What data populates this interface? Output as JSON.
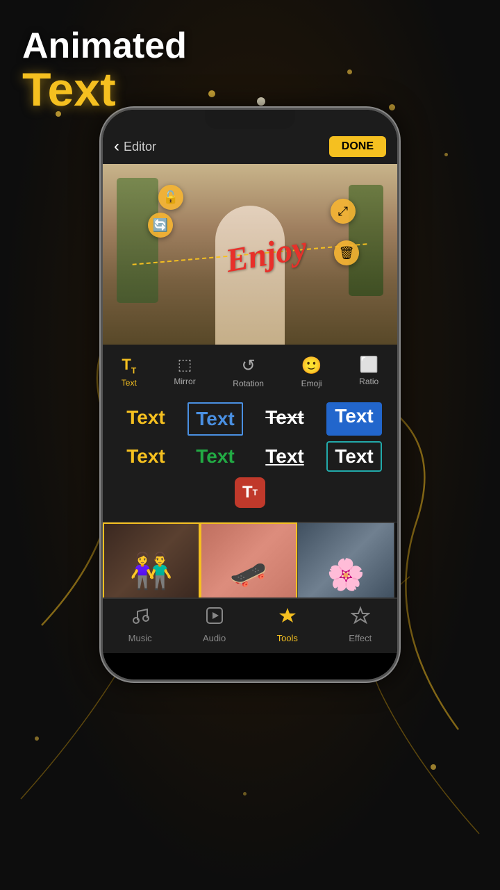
{
  "app": {
    "title_line1": "Animated",
    "title_line2": "Text",
    "colors": {
      "gold": "#f5c020",
      "white": "#ffffff",
      "dark_bg": "#1a1008",
      "active_gold": "#f5c020"
    }
  },
  "editor": {
    "back_icon": "‹",
    "label": "Editor",
    "done_button": "DONE",
    "enjoy_text": "Enjoy",
    "photo_icons": {
      "lock": "🔓",
      "rotate": "🔄",
      "move": "⤢",
      "trash": "🗑"
    }
  },
  "toolbar": {
    "items": [
      {
        "id": "text",
        "label": "Text",
        "icon": "Tₜ",
        "active": true
      },
      {
        "id": "mirror",
        "label": "Mirror",
        "icon": "⬚",
        "active": false
      },
      {
        "id": "rotation",
        "label": "Rotation",
        "icon": "↺",
        "active": false
      },
      {
        "id": "emoji",
        "label": "Emoji",
        "icon": "☺",
        "active": false
      },
      {
        "id": "ratio",
        "label": "Ratio",
        "icon": "⬜",
        "active": false
      }
    ]
  },
  "text_styles": {
    "row1": [
      {
        "label": "Text",
        "style": "yellow"
      },
      {
        "label": "Text",
        "style": "blue-outline"
      },
      {
        "label": "Text",
        "style": "strikethrough"
      },
      {
        "label": "Text",
        "style": "white-on-blue"
      }
    ],
    "row2": [
      {
        "label": "Text",
        "style": "yellow2"
      },
      {
        "label": "Text",
        "style": "green"
      },
      {
        "label": "Text",
        "style": "underline"
      },
      {
        "label": "Text",
        "style": "teal-border"
      }
    ],
    "tt_icon": "Tₜ"
  },
  "bottom_nav": {
    "items": [
      {
        "id": "music",
        "label": "Music",
        "icon": "♪",
        "active": false
      },
      {
        "id": "audio",
        "label": "Audio",
        "icon": "▷",
        "active": false
      },
      {
        "id": "tools",
        "label": "Tools",
        "icon": "★",
        "active": true
      },
      {
        "id": "effect",
        "label": "Effect",
        "icon": "★",
        "active": false
      }
    ]
  }
}
